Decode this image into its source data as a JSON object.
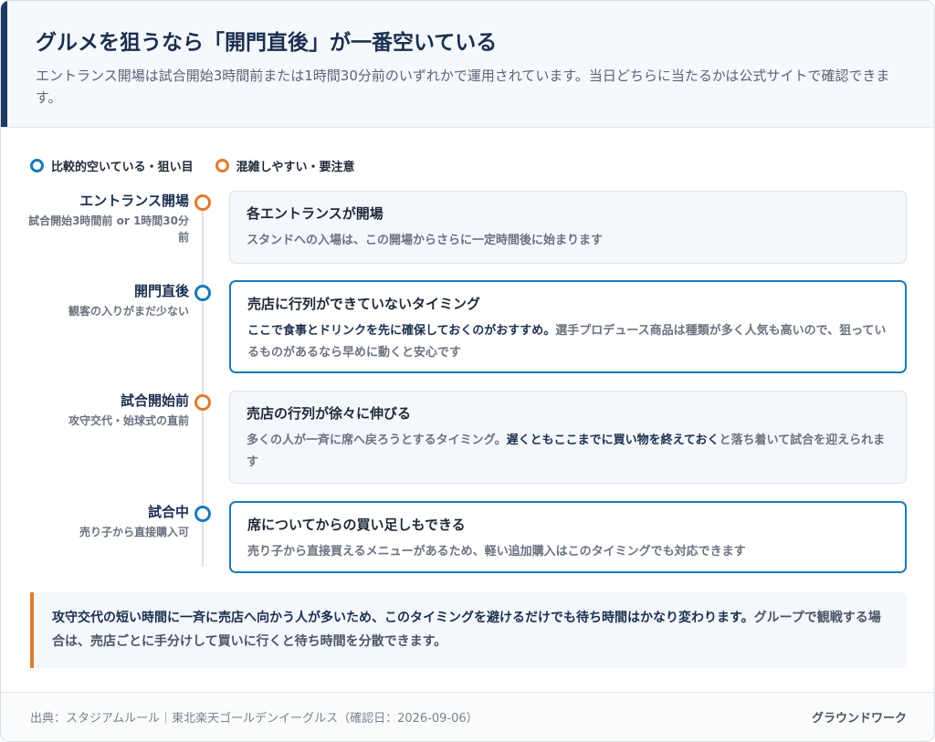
{
  "header": {
    "title": "グルメを狙うなら「開門直後」が一番空いている",
    "subtitle": "エントランス開場は試合開始3時間前または1時間30分前のいずれかで運用されています。当日どちらに当たるかは公式サイトで確認できます。"
  },
  "legend": [
    {
      "label": "比較的空いている・狙い目",
      "color": "#1a7ab8"
    },
    {
      "label": "混雑しやすい・要注意",
      "color": "#e07b2e"
    }
  ],
  "stages": [
    {
      "title": "エントランス開場",
      "sub": "試合開始3時間前 or 1時間30分前",
      "status": "busy",
      "box_title": "各エントランスが開場",
      "body": [
        {
          "text": "スタンドへの入場は、この開場からさらに一定時間後に始まります",
          "strong": false
        }
      ]
    },
    {
      "title": "開門直後",
      "sub": "観客の入りがまだ少ない",
      "status": "quiet",
      "box_title": "売店に行列ができていないタイミング",
      "body": [
        {
          "text": "ここで食事とドリンクを先に確保しておくのがおすすめ。",
          "strong": true
        },
        {
          "text": "選手プロデュース商品は種類が多く人気も高いので、狙っているものがあるなら早めに動くと安心です",
          "strong": false
        }
      ]
    },
    {
      "title": "試合開始前",
      "sub": "攻守交代・始球式の直前",
      "status": "busy",
      "box_title": "売店の行列が徐々に伸びる",
      "body": [
        {
          "text": "多くの人が一斉に席へ戻ろうとするタイミング。",
          "strong": false
        },
        {
          "text": "遅くともここまでに買い物を終えておく",
          "strong": true
        },
        {
          "text": "と落ち着いて試合を迎えられます",
          "strong": false
        }
      ]
    },
    {
      "title": "試合中",
      "sub": "売り子から直接購入可",
      "status": "quiet",
      "box_title": "席についてからの買い足しもできる",
      "body": [
        {
          "text": "売り子から直接買えるメニューがあるため、軽い追加購入はこのタイミングでも対応できます",
          "strong": false
        }
      ]
    }
  ],
  "note": [
    {
      "text": "攻守交代の短い時間に一斉に売店へ向かう人が多いため、このタイミングを避けるだけでも待ち時間はかなり変わります。",
      "strong": true
    },
    {
      "text": "グループで観戦する場合は、売店ごとに手分けして買いに行くと待ち時間を分散できます。",
      "strong": false
    }
  ],
  "footer": {
    "source": "出典：スタジアムルール｜東北楽天ゴールデンイーグルス（確認日：2026-09-06）",
    "brand": "グラウンドワーク"
  },
  "colors": {
    "quiet": "#1a7ab8",
    "busy": "#e07b2e",
    "navy": "#1b2f4f"
  }
}
